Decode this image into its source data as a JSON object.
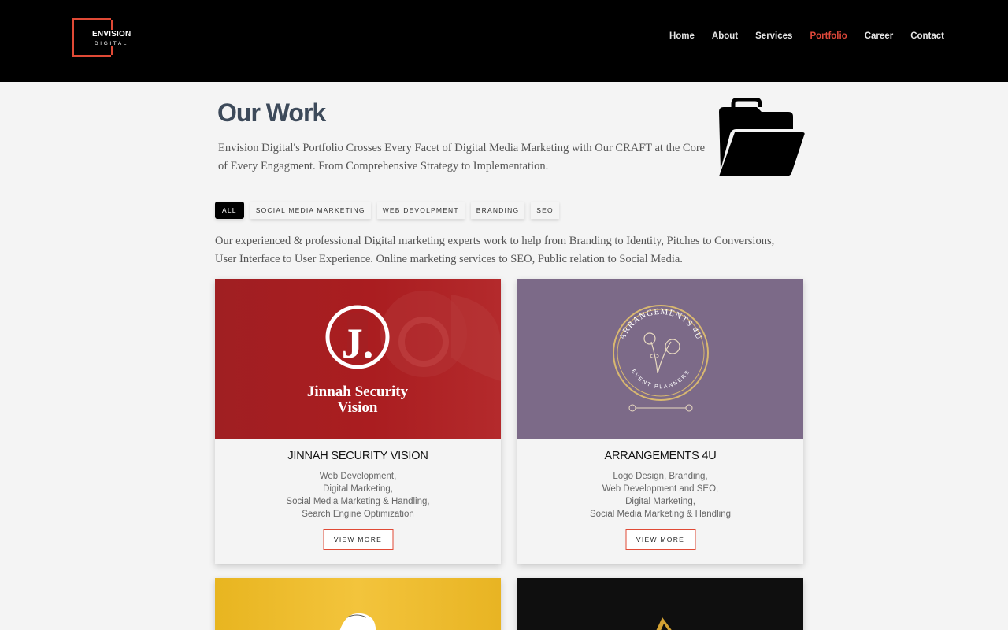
{
  "brand": {
    "line1": "ENVISION",
    "line2": "DIGITAL",
    "accent": "#e04a36"
  },
  "nav": [
    {
      "label": "Home",
      "active": false
    },
    {
      "label": "About",
      "active": false
    },
    {
      "label": "Services",
      "active": false
    },
    {
      "label": "Portfolio",
      "active": true
    },
    {
      "label": "Career",
      "active": false
    },
    {
      "label": "Contact",
      "active": false
    }
  ],
  "page": {
    "title": "Our Work",
    "intro": "Envision Digital's Portfolio Crosses Every Facet of Digital Media Marketing with Our CRAFT at the Core of Every Engagment. From Comprehensive Strategy to Implementation.",
    "icon": "open-folder-icon",
    "description": "Our experienced & professional Digital marketing experts work to help from Branding to Identity, Pitches to Conversions, User Interface to User Experience. Online marketing services to SEO, Public relation to Social Media."
  },
  "filters": [
    {
      "label": "ALL",
      "active": true
    },
    {
      "label": "SOCIAL MEDIA MARKETING",
      "active": false
    },
    {
      "label": "WEB DEVOLPMENT",
      "active": false
    },
    {
      "label": "BRANDING",
      "active": false
    },
    {
      "label": "SEO",
      "active": false
    }
  ],
  "cards": [
    {
      "title": "JINNAH SECURITY VISION",
      "logo_letter": "J.",
      "logo_line1": "Jinnah Security",
      "logo_line2": "Vision",
      "services": [
        "Web Development,",
        "Digital Marketing,",
        "Social Media Marketing & Handling,",
        "Search Engine Optimization"
      ],
      "button": "VIEW MORE"
    },
    {
      "title": "ARRANGEMENTS 4U",
      "logo_top": "ARRANGEMENTS 4U",
      "logo_bottom": "EVENT PLANNERS",
      "services": [
        "Logo Design, Branding,",
        "Web Development and SEO,",
        "Digital Marketing,",
        "Social Media Marketing & Handling"
      ],
      "button": "VIEW MORE"
    }
  ]
}
